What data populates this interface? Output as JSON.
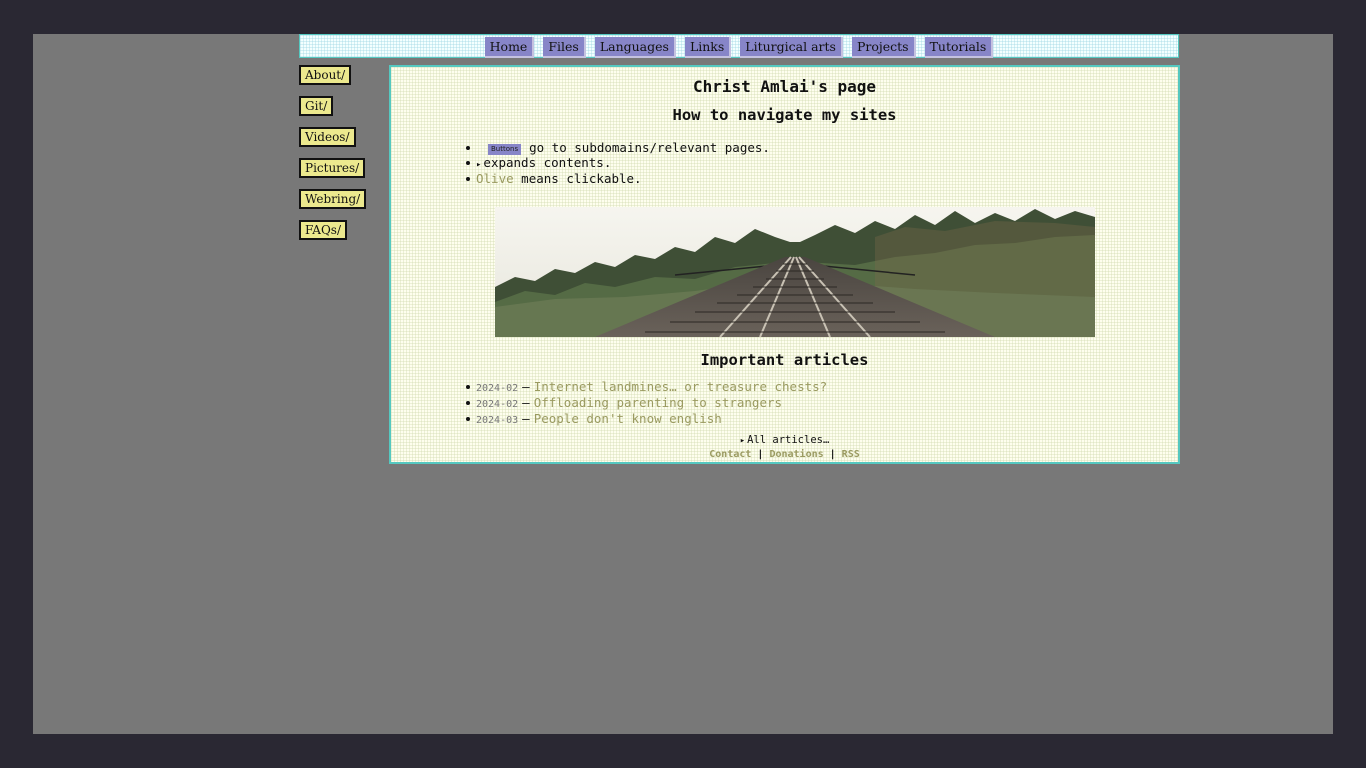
{
  "top_nav": {
    "items": [
      {
        "label": "Home"
      },
      {
        "label": "Files"
      },
      {
        "label": "Languages"
      },
      {
        "label": "Links"
      },
      {
        "label": "Liturgical arts"
      },
      {
        "label": "Projects"
      },
      {
        "label": "Tutorials"
      }
    ]
  },
  "sidebar": {
    "items": [
      {
        "label": "About/"
      },
      {
        "label": "Git/"
      },
      {
        "label": "Videos/"
      },
      {
        "label": "Pictures/"
      },
      {
        "label": "Webring/"
      },
      {
        "label": "FAQs/"
      }
    ]
  },
  "main": {
    "title": "Christ Amlai's page",
    "navigate_heading": "How to navigate my sites",
    "nav_help": {
      "button_sample": "Buttons",
      "button_text": "go to subdomains/relevant pages.",
      "expand_marker": "▸",
      "expand_text": "expands contents.",
      "olive_word": "Olive",
      "olive_text": "means clickable."
    },
    "articles_heading": "Important articles",
    "articles": [
      {
        "date": "2024-02",
        "title": "Internet landmines… or treasure chests?"
      },
      {
        "date": "2024-02",
        "title": "Offloading parenting to strangers"
      },
      {
        "date": "2024-03",
        "title": "People don't know english"
      }
    ],
    "dash": "–",
    "all_articles_marker": "▸",
    "all_articles_label": "All articles…",
    "footer": {
      "contact": "Contact",
      "donations": "Donations",
      "rss": "RSS",
      "separator": "|"
    }
  },
  "colors": {
    "page_bg": "#2a2833",
    "stage_bg": "#787878",
    "nav_button": "#8785c8",
    "side_button": "#ece98e",
    "accent_border": "#55c8c0",
    "olive_link": "#9a9a60",
    "content_bg": "#fefeee"
  },
  "icons": {
    "expand": "triangle-right-icon",
    "banner": "railway-bridge-forest-image"
  }
}
